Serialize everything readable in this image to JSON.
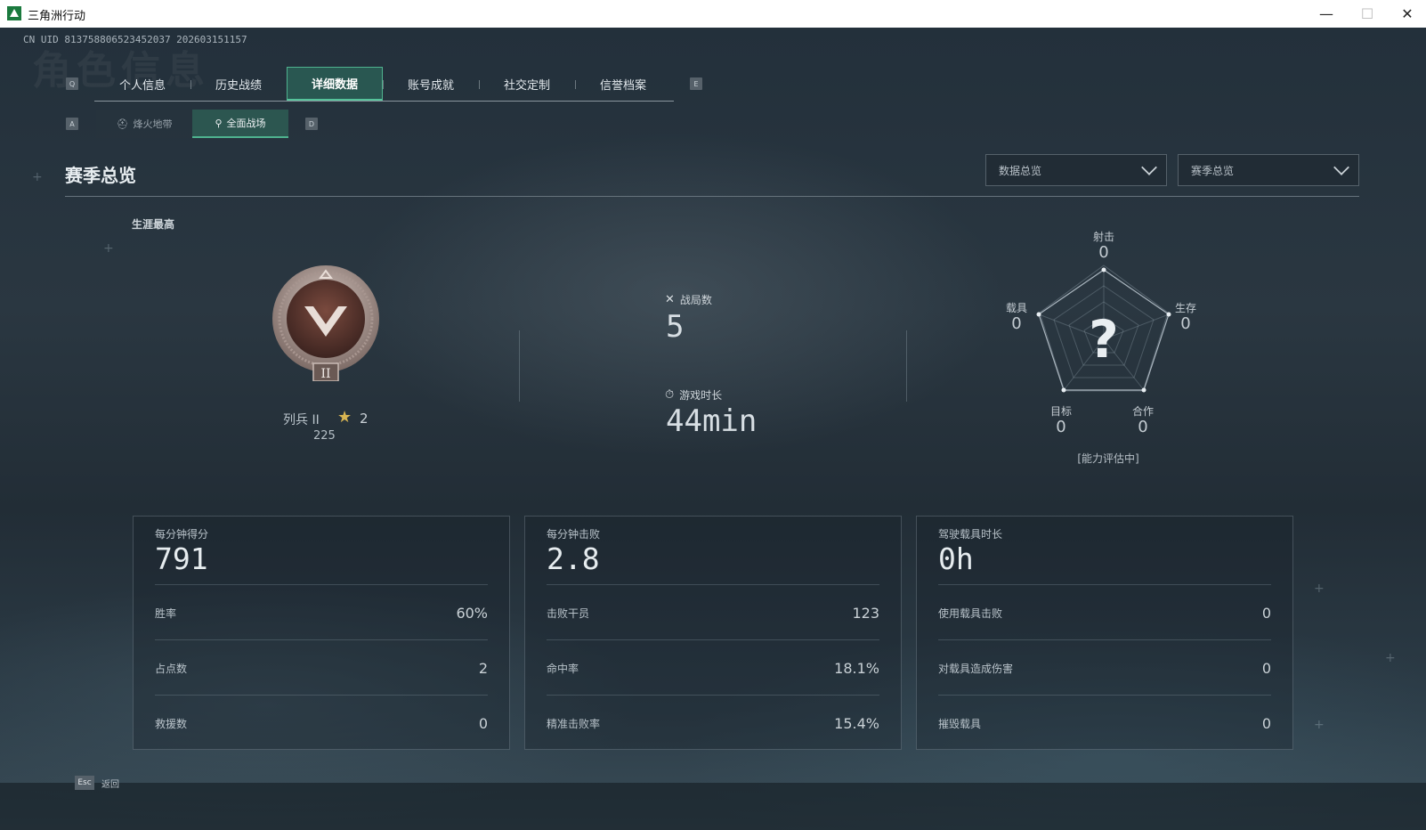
{
  "window": {
    "title": "三角洲行动",
    "min_label": "—",
    "max_label": "☐",
    "close_label": "✕"
  },
  "uid": "CN UID 813758806523452037 202603151157",
  "bg_title": "角色信息",
  "key_hints": {
    "tab_prev": "Q",
    "tab_next": "E",
    "sub_prev": "A",
    "sub_next": "D"
  },
  "tabs": [
    {
      "label": "个人信息"
    },
    {
      "label": "历史战绩"
    },
    {
      "label": "详细数据"
    },
    {
      "label": "账号成就"
    },
    {
      "label": "社交定制"
    },
    {
      "label": "信誉档案"
    }
  ],
  "active_tab": "详细数据",
  "sub_tabs": [
    {
      "label": "烽火地带",
      "icon": "helmet-icon"
    },
    {
      "label": "全面战场",
      "icon": "antenna-icon"
    }
  ],
  "active_sub_tab": "全面战场",
  "section": {
    "title": "赛季总览"
  },
  "dropdowns": {
    "data_scope": "数据总览",
    "season_scope": "赛季总览"
  },
  "career": {
    "label": "生涯最高",
    "rank_name": "列兵 II",
    "rank_numeral": "II",
    "stars": "2",
    "points": "225"
  },
  "summary": {
    "matches_label": "战局数",
    "matches_value": "5",
    "playtime_label": "游戏时长",
    "playtime_value": "44min"
  },
  "radar": {
    "axes": [
      {
        "key": "shooting",
        "label": "射击",
        "value": "0"
      },
      {
        "key": "survival",
        "label": "生存",
        "value": "0"
      },
      {
        "key": "teamwork",
        "label": "合作",
        "value": "0"
      },
      {
        "key": "objective",
        "label": "目标",
        "value": "0"
      },
      {
        "key": "vehicle",
        "label": "载具",
        "value": "0"
      }
    ],
    "center_mark": "?",
    "status": "[能力评估中]"
  },
  "cards": [
    {
      "head_label": "每分钟得分",
      "head_value": "791",
      "rows": [
        {
          "k": "胜率",
          "v": "60%"
        },
        {
          "k": "占点数",
          "v": "2"
        },
        {
          "k": "救援数",
          "v": "0"
        }
      ]
    },
    {
      "head_label": "每分钟击败",
      "head_value": "2.8",
      "rows": [
        {
          "k": "击败干员",
          "v": "123"
        },
        {
          "k": "命中率",
          "v": "18.1%"
        },
        {
          "k": "精准击败率",
          "v": "15.4%"
        }
      ]
    },
    {
      "head_label": "驾驶载具时长",
      "head_value": "0h",
      "rows": [
        {
          "k": "使用载具击败",
          "v": "0"
        },
        {
          "k": "对载具造成伤害",
          "v": "0"
        },
        {
          "k": "摧毁载具",
          "v": "0"
        }
      ]
    }
  ],
  "footer": {
    "esc_key": "Esc",
    "back_label": "返回"
  },
  "colors": {
    "accent": "#4fb38f",
    "star": "#d8b552",
    "badge": "#5a3a33"
  }
}
